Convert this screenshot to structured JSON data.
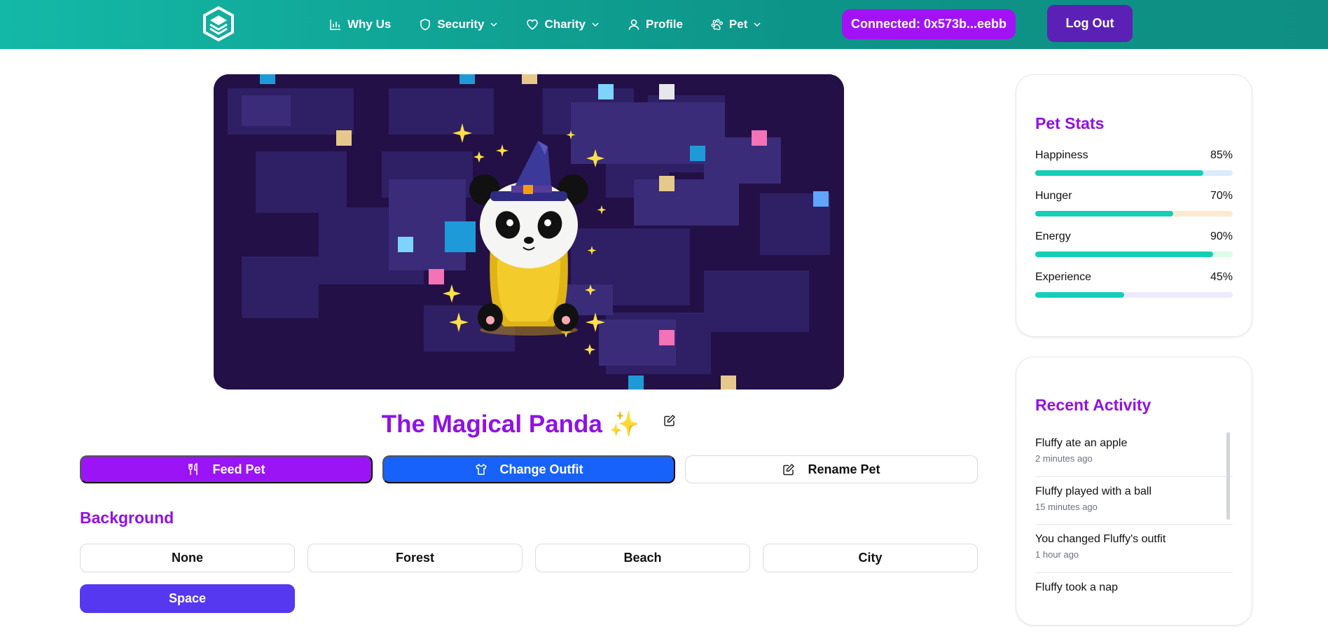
{
  "header": {
    "nav": [
      {
        "label": "Why Us",
        "icon": "bar-chart-icon",
        "dropdown": false
      },
      {
        "label": "Security",
        "icon": "shield-icon",
        "dropdown": true
      },
      {
        "label": "Charity",
        "icon": "heart-icon",
        "dropdown": true
      },
      {
        "label": "Profile",
        "icon": "user-icon",
        "dropdown": false
      },
      {
        "label": "Pet",
        "icon": "paw-icon",
        "dropdown": true
      }
    ],
    "connected_label": "Connected: 0x573b...eebb",
    "logout_label": "Log Out"
  },
  "pet": {
    "name": "The Magical Panda ✨",
    "background": "Space"
  },
  "actions": {
    "feed": "Feed Pet",
    "outfit": "Change Outfit",
    "rename": "Rename Pet"
  },
  "background_section": {
    "heading": "Background",
    "options": [
      "None",
      "Forest",
      "Beach",
      "City",
      "Space"
    ],
    "selected": "Space"
  },
  "stats": {
    "title": "Pet Stats",
    "items": [
      {
        "label": "Happiness",
        "value": "85%",
        "fraction": 0.85,
        "track_color": "#dbeafe"
      },
      {
        "label": "Hunger",
        "value": "70%",
        "fraction": 0.7,
        "track_color": "#fde9d2"
      },
      {
        "label": "Energy",
        "value": "90%",
        "fraction": 0.9,
        "track_color": "#dcfce7"
      },
      {
        "label": "Experience",
        "value": "45%",
        "fraction": 0.45,
        "track_color": "#ede9fe"
      }
    ]
  },
  "activity": {
    "title": "Recent Activity",
    "items": [
      {
        "text": "Fluffy ate an apple",
        "time": "2 minutes ago"
      },
      {
        "text": "Fluffy played with a ball",
        "time": "15 minutes ago"
      },
      {
        "text": "You changed Fluffy's outfit",
        "time": "1 hour ago"
      },
      {
        "text": "Fluffy took a nap",
        "time": ""
      }
    ]
  },
  "colors": {
    "header_teal": "#14b8a6",
    "brand_purple": "#9011e6",
    "feed_button": "#9b14f5",
    "outfit_button": "#1763fa",
    "space_button": "#5538f0",
    "logout_button": "#5b21b6",
    "connected_button": "#a112f5",
    "stat_fill": "#14cfb6"
  }
}
